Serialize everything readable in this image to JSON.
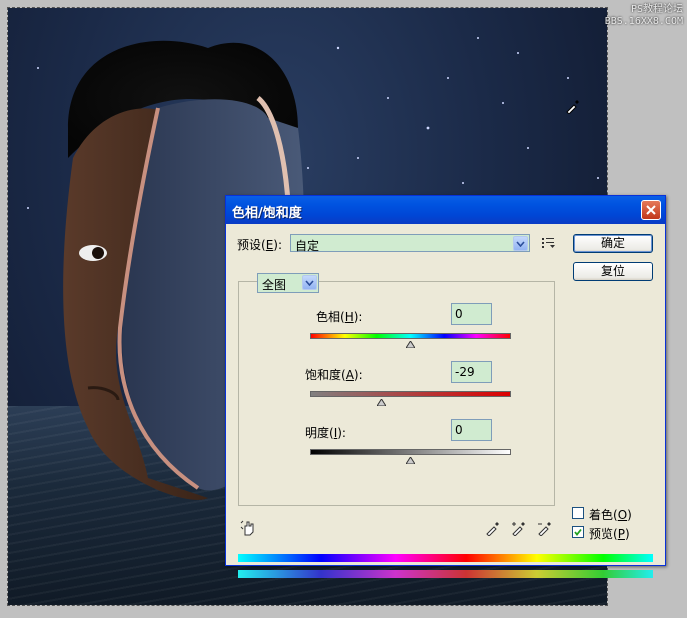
{
  "watermark": {
    "line1": "PS教程论坛",
    "line2": "BBS.16XX8.COM"
  },
  "dialog": {
    "title": "色相/饱和度",
    "preset_label_text": "预设",
    "preset_key": "E",
    "preset_value": "自定",
    "ok_label": "确定",
    "reset_label": "复位",
    "channel_value": "全图",
    "hue": {
      "label_text": "色相",
      "key": "H",
      "value": "0",
      "slider_fraction": 0.5
    },
    "saturation": {
      "label_text": "饱和度",
      "key": "A",
      "value": "-29",
      "slider_fraction": 0.355
    },
    "lightness": {
      "label_text": "明度",
      "key": "I",
      "value": "0",
      "slider_fraction": 0.5
    },
    "colorize": {
      "label_text": "着色",
      "key": "O",
      "checked": false
    },
    "preview": {
      "label_text": "预览",
      "key": "P",
      "checked": true
    }
  },
  "icons": {
    "close": "close-icon",
    "preset_options": "preset-options-icon",
    "targeted_adjust": "hand-adjust-icon",
    "eyedropper": "eyedropper-icon",
    "eyedropper_add": "eyedropper-plus-icon",
    "eyedropper_subtract": "eyedropper-minus-icon"
  },
  "colors": {
    "title_bar": "#0054e3",
    "dialog_bg": "#ece9d8",
    "field_bg": "#d0ebd0"
  }
}
